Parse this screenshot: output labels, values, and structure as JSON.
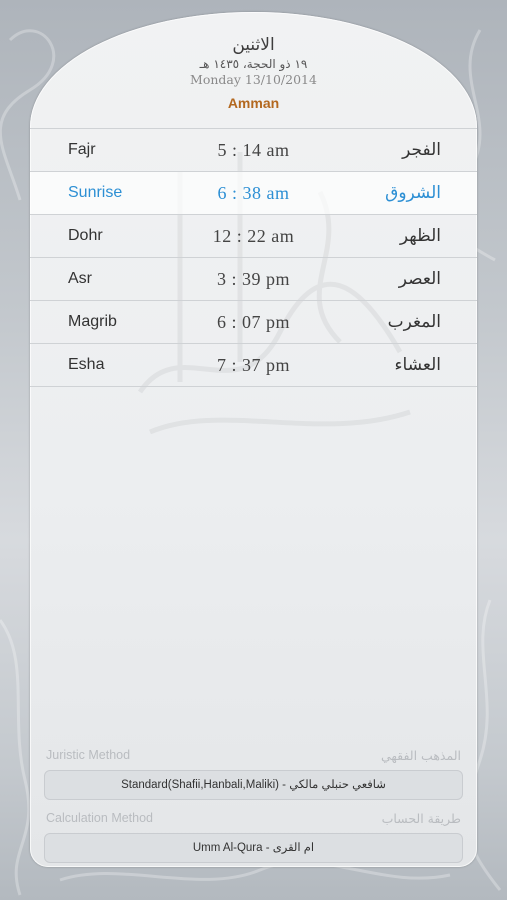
{
  "header": {
    "hijri_day": "الاثنين",
    "hijri_date": "١٩ ذو الحجة، ١٤٣٥ هـ",
    "gregorian_date": "Monday 13/10/2014",
    "city": "Amman"
  },
  "prayers": [
    {
      "name_en": "Fajr",
      "time": "5 : 14 am",
      "name_ar": "الفجر",
      "current": false
    },
    {
      "name_en": "Sunrise",
      "time": "6 : 38 am",
      "name_ar": "الشروق",
      "current": true
    },
    {
      "name_en": "Dohr",
      "time": "12 : 22 am",
      "name_ar": "الظهر",
      "current": false
    },
    {
      "name_en": "Asr",
      "time": "3 : 39 pm",
      "name_ar": "العصر",
      "current": false
    },
    {
      "name_en": "Magrib",
      "time": "6 : 07 pm",
      "name_ar": "المغرب",
      "current": false
    },
    {
      "name_en": "Esha",
      "time": "7 : 37 pm",
      "name_ar": "العشاء",
      "current": false
    }
  ],
  "settings": {
    "juristic": {
      "label_en": "Juristic Method",
      "label_ar": "المذهب الفقهي",
      "value": "Standard(Shafii,Hanbali,Maliki) - شافعي حنبلي مالكي"
    },
    "calculation": {
      "label_en": "Calculation Method",
      "label_ar": "طريقة الحساب",
      "value": "Umm Al-Qura - ام القرى"
    }
  },
  "colors": {
    "accent_current": "#2c8fd4",
    "city": "#b3681f"
  }
}
